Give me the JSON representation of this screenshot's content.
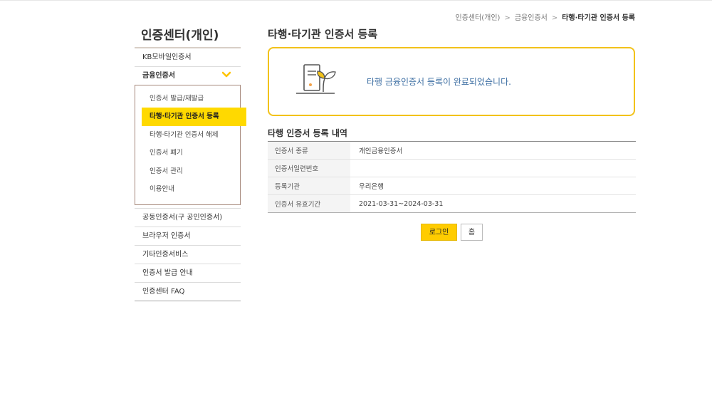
{
  "breadcrumb": [
    "인증센터(개인)",
    "금융인증서",
    "타행·타기관 인증서 등록"
  ],
  "sidebar": {
    "title": "인증센터(개인)",
    "items": [
      {
        "label": "KB모바일인증서"
      },
      {
        "label": "금융인증서",
        "expanded": true
      },
      {
        "label": "공동인증서(구 공인인증서)"
      },
      {
        "label": "브라우저 인증서"
      },
      {
        "label": "기타인증서비스"
      },
      {
        "label": "인증서 발급 안내"
      },
      {
        "label": "인증센터 FAQ"
      }
    ],
    "submenu": [
      {
        "label": "인증서 발급/재발급"
      },
      {
        "label": "타행·타기관 인증서 등록",
        "active": true
      },
      {
        "label": "타행·타기관 인증서 해제"
      },
      {
        "label": "인증서 폐기"
      },
      {
        "label": "인증서 관리"
      },
      {
        "label": "이용안내"
      }
    ]
  },
  "main": {
    "title": "타행·타기관 인증서 등록",
    "notice": "타행 금융인증서 등록이 완료되었습니다.",
    "section_title": "타행 인증서 등록 내역",
    "rows": [
      {
        "label": "인증서 종류",
        "value": "개인금융인증서"
      },
      {
        "label": "인증서일련번호",
        "value": ""
      },
      {
        "label": "등록기관",
        "value": "우리은행"
      },
      {
        "label": "인증서 유효기간",
        "value": "2021-03-31~2024-03-31"
      }
    ],
    "buttons": {
      "login": "로그인",
      "home": "홈"
    }
  },
  "colors": {
    "accent": "#ffd900",
    "notice_border": "#f2c21a",
    "notice_text": "#3e6fa3",
    "submenu_border": "#a5877a"
  },
  "icons": {
    "notice": "certificate-leaf-icon",
    "expand": "chevron-down-icon"
  }
}
